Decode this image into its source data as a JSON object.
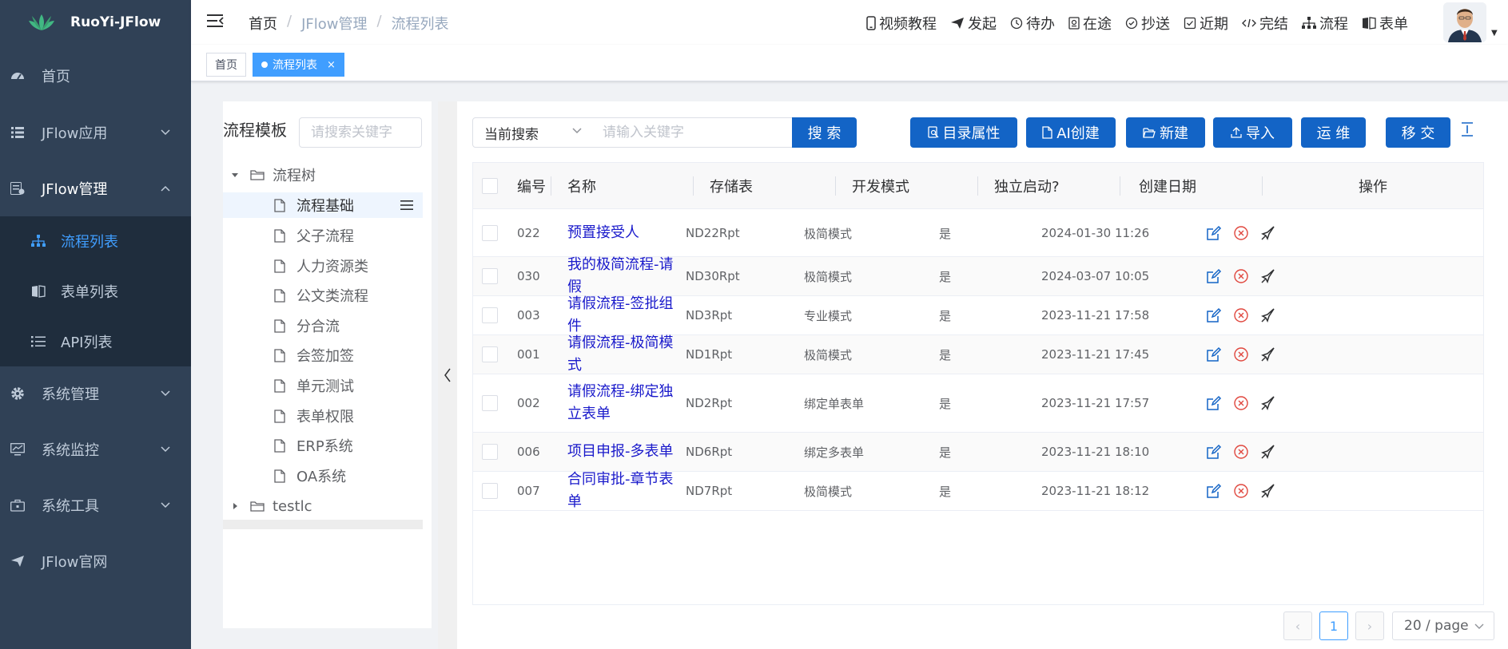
{
  "app": {
    "title": "RuoYi-JFlow"
  },
  "sidebar": {
    "items": [
      {
        "label": "首页",
        "icon": "dashboard-icon"
      },
      {
        "label": "JFlow应用",
        "icon": "list-icon"
      },
      {
        "label": "JFlow管理",
        "icon": "form-icon"
      },
      {
        "label": "系统管理",
        "icon": "gear-icon"
      },
      {
        "label": "系统监控",
        "icon": "monitor-icon"
      },
      {
        "label": "系统工具",
        "icon": "toolbox-icon"
      },
      {
        "label": "JFlow官网",
        "icon": "send-icon"
      }
    ],
    "submenu": [
      {
        "label": "流程列表",
        "icon": "tree-structure-icon"
      },
      {
        "label": "表单列表",
        "icon": "book-icon"
      },
      {
        "label": "API列表",
        "icon": "bullet-list-icon"
      }
    ]
  },
  "navbar": {
    "breadcrumb": [
      "首页",
      "JFlow管理",
      "流程列表"
    ],
    "links": [
      {
        "label": "视频教程",
        "icon": "mobile-icon"
      },
      {
        "label": "发起",
        "icon": "paper-plane-icon"
      },
      {
        "label": "待办",
        "icon": "clock-icon"
      },
      {
        "label": "在途",
        "icon": "document-icon"
      },
      {
        "label": "抄送",
        "icon": "check-circle-icon"
      },
      {
        "label": "近期",
        "icon": "checkbox-icon"
      },
      {
        "label": "完结",
        "icon": "code-icon"
      },
      {
        "label": "流程",
        "icon": "flow-icon"
      },
      {
        "label": "表单",
        "icon": "book-icon"
      }
    ]
  },
  "tags": {
    "home": "首页",
    "active": "流程列表",
    "close": "×"
  },
  "tree": {
    "title": "流程模板",
    "search_placeholder": "请搜索关键字",
    "root": "流程树",
    "nodes": [
      "流程基础",
      "父子流程",
      "人力资源类",
      "公文类流程",
      "分合流",
      "会签加签",
      "单元测试",
      "表单权限",
      "ERP系统",
      "OA系统"
    ],
    "other_root": "testlc"
  },
  "toolbar": {
    "search_scope": "当前搜索",
    "search_placeholder": "请输入关键字",
    "search": "搜 索",
    "catalog": "目录属性",
    "ai": "AI创建",
    "new": "新建",
    "import": "导入",
    "ops": "运 维",
    "move": "移 交"
  },
  "table": {
    "headers": {
      "no": "编号",
      "name": "名称",
      "store": "存储表",
      "mode": "开发模式",
      "standalone": "独立启动?",
      "created": "创建日期",
      "actions": "操作"
    },
    "rows": [
      {
        "no": "022",
        "name": "预置接受人",
        "store": "ND22Rpt",
        "mode": "极简模式",
        "standalone": "是",
        "created": "2024-01-30 11:26"
      },
      {
        "no": "030",
        "name": "我的极简流程-请假",
        "store": "ND30Rpt",
        "mode": "极简模式",
        "standalone": "是",
        "created": "2024-03-07 10:05"
      },
      {
        "no": "003",
        "name": "请假流程-签批组件",
        "store": "ND3Rpt",
        "mode": "专业模式",
        "standalone": "是",
        "created": "2023-11-21 17:58"
      },
      {
        "no": "001",
        "name": "请假流程-极简模式",
        "store": "ND1Rpt",
        "mode": "极简模式",
        "standalone": "是",
        "created": "2023-11-21 17:45"
      },
      {
        "no": "002",
        "name": "请假流程-绑定独立表单",
        "store": "ND2Rpt",
        "mode": "绑定单表单",
        "standalone": "是",
        "created": "2023-11-21 17:57"
      },
      {
        "no": "006",
        "name": "项目申报-多表单",
        "store": "ND6Rpt",
        "mode": "绑定多表单",
        "standalone": "是",
        "created": "2023-11-21 18:10"
      },
      {
        "no": "007",
        "name": "合同审批-章节表单",
        "store": "ND7Rpt",
        "mode": "极简模式",
        "standalone": "是",
        "created": "2023-11-21 18:12"
      }
    ]
  },
  "pagination": {
    "prev": "‹",
    "page": "1",
    "next": "›",
    "page_size": "20 / page"
  },
  "colors": {
    "sidebar": "#304156",
    "submenu": "#1f2d3d",
    "accent": "#409eff",
    "button": "#1364c6",
    "link": "#1a1acb"
  }
}
